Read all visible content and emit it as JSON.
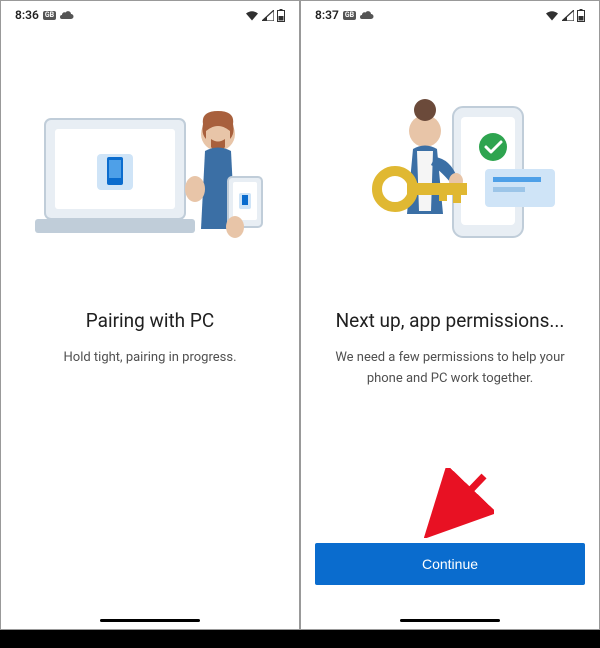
{
  "screen1": {
    "status": {
      "time": "8:36",
      "badge": "GB"
    },
    "title": "Pairing with PC",
    "subtitle": "Hold tight, pairing in progress."
  },
  "screen2": {
    "status": {
      "time": "8:37",
      "badge": "GB"
    },
    "title": "Next up, app permissions...",
    "subtitle": "We need a few permissions to help your phone and PC work together.",
    "button": "Continue"
  }
}
